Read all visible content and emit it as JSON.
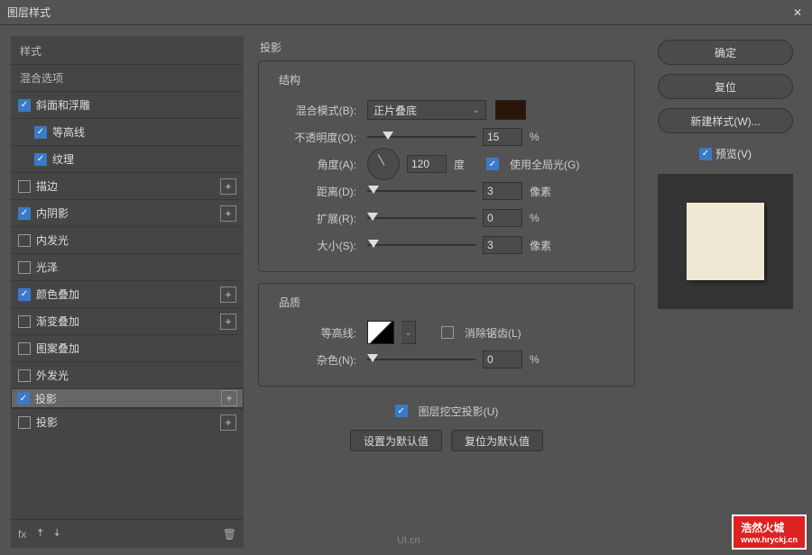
{
  "dialog": {
    "title": "图层样式",
    "close": "✕"
  },
  "left": {
    "header": "样式",
    "header2": "混合选项",
    "items": [
      {
        "label": "斜面和浮雕",
        "checked": true,
        "plus": false,
        "sub": false
      },
      {
        "label": "等高线",
        "checked": true,
        "plus": false,
        "sub": true
      },
      {
        "label": "纹理",
        "checked": true,
        "plus": false,
        "sub": true
      },
      {
        "label": "描边",
        "checked": false,
        "plus": true,
        "sub": false
      },
      {
        "label": "内阴影",
        "checked": true,
        "plus": true,
        "sub": false
      },
      {
        "label": "内发光",
        "checked": false,
        "plus": false,
        "sub": false
      },
      {
        "label": "光泽",
        "checked": false,
        "plus": false,
        "sub": false
      },
      {
        "label": "颜色叠加",
        "checked": true,
        "plus": true,
        "sub": false
      },
      {
        "label": "渐变叠加",
        "checked": false,
        "plus": true,
        "sub": false
      },
      {
        "label": "图案叠加",
        "checked": false,
        "plus": false,
        "sub": false
      },
      {
        "label": "外发光",
        "checked": false,
        "plus": false,
        "sub": false
      },
      {
        "label": "投影",
        "checked": true,
        "plus": true,
        "sub": false,
        "selected": true
      },
      {
        "label": "投影",
        "checked": false,
        "plus": true,
        "sub": false
      }
    ],
    "fx": "fx",
    "up": "🠥",
    "down": "🠧",
    "trash": "🗑"
  },
  "mid": {
    "section": "投影",
    "group1": "结构",
    "blend_label": "混合模式(B):",
    "blend_value": "正片叠底",
    "blend_color": "#2a1608",
    "opacity_label": "不透明度(O):",
    "opacity_value": "15",
    "pct": "%",
    "angle_label": "角度(A):",
    "angle_value": "120",
    "deg": "度",
    "global_label": "使用全局光(G)",
    "global_checked": true,
    "distance_label": "距离(D):",
    "distance_value": "3",
    "px": "像素",
    "spread_label": "扩展(R):",
    "spread_value": "0",
    "size_label": "大小(S):",
    "size_value": "3",
    "group2": "品质",
    "contour_label": "等高线:",
    "antialias_label": "消除锯齿(L)",
    "antialias_checked": false,
    "noise_label": "杂色(N):",
    "noise_value": "0",
    "knockout_label": "图层挖空投影(U)",
    "knockout_checked": true,
    "btn_default": "设置为默认值",
    "btn_reset": "复位为默认值"
  },
  "right": {
    "ok": "确定",
    "cancel": "复位",
    "newstyle": "新建样式(W)...",
    "preview_label": "预览(V)",
    "preview_checked": true
  },
  "watermark": {
    "big": "浩然火城",
    "url": "www.hryckj.cn"
  },
  "uicn": "UI.cn"
}
